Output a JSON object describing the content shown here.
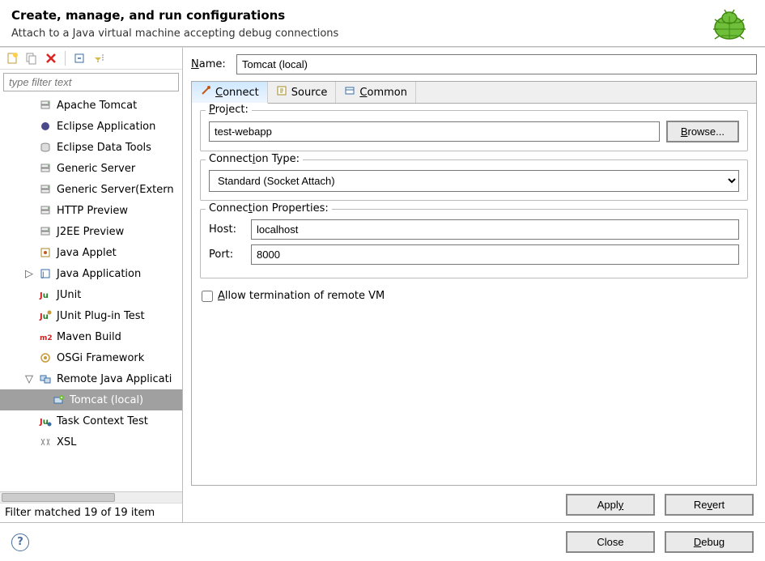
{
  "header": {
    "title": "Create, manage, and run configurations",
    "subtitle": "Attach to a Java virtual machine accepting debug connections"
  },
  "filter": {
    "placeholder": "type filter text",
    "status": "Filter matched 19 of 19 item"
  },
  "tree": [
    {
      "label": "Apache Tomcat",
      "icon": "server"
    },
    {
      "label": "Eclipse Application",
      "icon": "eclipse"
    },
    {
      "label": "Eclipse Data Tools",
      "icon": "db"
    },
    {
      "label": "Generic Server",
      "icon": "server"
    },
    {
      "label": "Generic Server(Extern",
      "icon": "server"
    },
    {
      "label": "HTTP Preview",
      "icon": "server"
    },
    {
      "label": "J2EE Preview",
      "icon": "server"
    },
    {
      "label": "Java Applet",
      "icon": "applet"
    },
    {
      "label": "Java Application",
      "icon": "java",
      "expander": "▷"
    },
    {
      "label": "JUnit",
      "icon": "junit"
    },
    {
      "label": "JUnit Plug-in Test",
      "icon": "junitp"
    },
    {
      "label": "Maven Build",
      "icon": "maven"
    },
    {
      "label": "OSGi Framework",
      "icon": "osgi"
    },
    {
      "label": "Remote Java Applicati",
      "icon": "remote",
      "expander": "▽"
    },
    {
      "label": "Tomcat (local)",
      "icon": "launch",
      "depth": 2,
      "selected": true
    },
    {
      "label": "Task Context Test",
      "icon": "task"
    },
    {
      "label": "XSL",
      "icon": "xsl"
    }
  ],
  "form": {
    "name_label_u": "N",
    "name_label_rest": "ame:",
    "name_value": "Tomcat (local)",
    "tabs": {
      "connect_u": "C",
      "connect_rest": "onnect",
      "source": "Source",
      "common_u": "C",
      "common_rest": "ommon"
    },
    "project_label_u": "P",
    "project_label_rest": "roject:",
    "project_value": "test-webapp",
    "browse_label_u": "B",
    "browse_label_rest": "rowse...",
    "conn_type_label_a": "Connect",
    "conn_type_label_u": "i",
    "conn_type_label_b": "on Type:",
    "conn_type_value": "Standard (Socket Attach)",
    "conn_props_label_a": "Connec",
    "conn_props_label_u": "t",
    "conn_props_label_b": "ion Properties:",
    "host_label": "Host:",
    "host_value": "localhost",
    "port_label": "Port:",
    "port_value": "8000",
    "allow_term_u": "A",
    "allow_term_rest": "llow termination of remote VM"
  },
  "buttons": {
    "apply_a": "Appl",
    "apply_u": "y",
    "revert_a": "Re",
    "revert_u": "v",
    "revert_b": "ert",
    "close": "Close",
    "debug_u": "D",
    "debug_rest": "ebug"
  }
}
